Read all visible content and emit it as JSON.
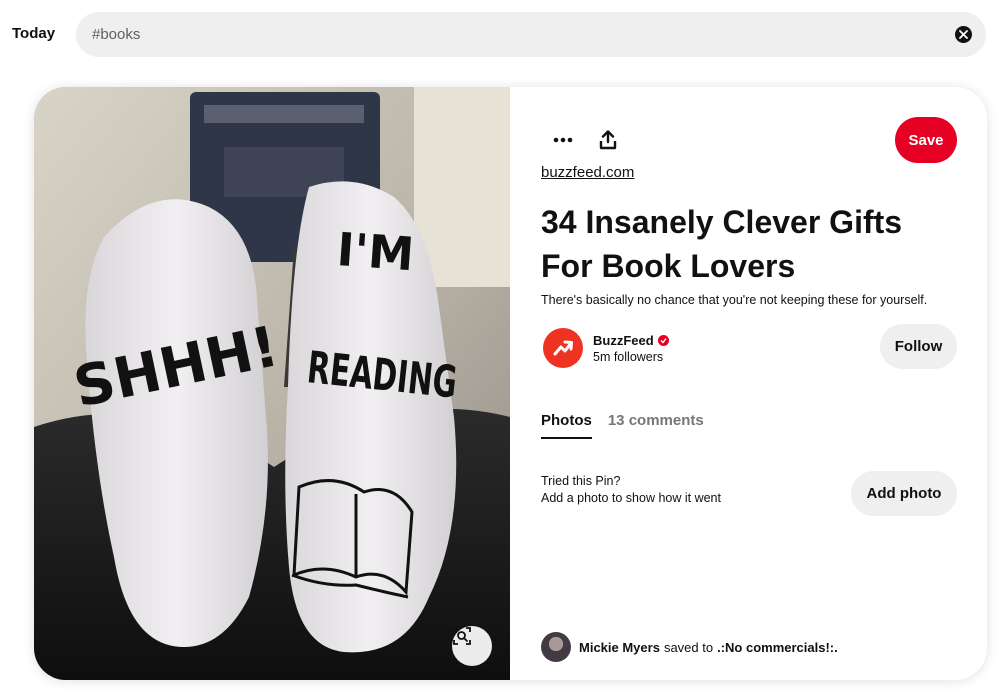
{
  "header": {
    "today_label": "Today",
    "search_value": "#books"
  },
  "pin": {
    "image_alt": "Socks reading SHHH! I'M READING",
    "sock_left_text": "SHHH!",
    "sock_right_text_1": "I'M",
    "sock_right_text_2": "READING",
    "save_label": "Save",
    "source_link": "buzzfeed.com",
    "title": "34 Insanely Clever Gifts For Book Lovers",
    "description": "There's basically no chance that you're not keeping these for yourself.",
    "creator": {
      "name": "BuzzFeed",
      "followers": "5m followers"
    },
    "follow_label": "Follow",
    "tabs": [
      {
        "label": "Photos",
        "active": true
      },
      {
        "label": "13 comments",
        "active": false
      }
    ],
    "tried": {
      "line1": "Tried this Pin?",
      "line2": "Add a photo to show how it went"
    },
    "add_photo_label": "Add photo",
    "saved_by": {
      "user": "Mickie Myers",
      "connector": "saved to",
      "board": ".:No commercials!:."
    }
  },
  "colors": {
    "brand_red": "#e60023",
    "pill_gray": "#efefef",
    "buzzfeed_red": "#ee3322"
  },
  "icons": [
    "clear-icon",
    "more-icon",
    "share-icon",
    "visual-search-icon",
    "verified-icon",
    "trending-arrow-icon"
  ]
}
